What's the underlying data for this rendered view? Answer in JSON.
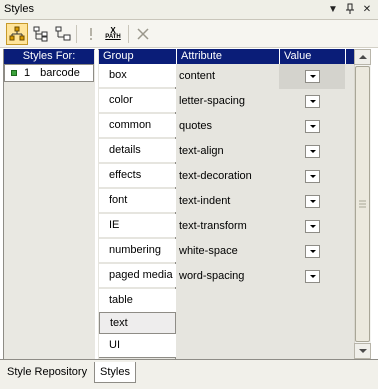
{
  "panel": {
    "title": "Styles",
    "controls": {
      "menu": "▼",
      "pin": "📌",
      "close": "✕"
    }
  },
  "toolbar": {
    "items": [
      {
        "name": "hierarchy-view-icon",
        "active": true
      },
      {
        "name": "tree-view-icon",
        "active": false
      },
      {
        "name": "tree-view-alt-icon",
        "active": false
      },
      {
        "name": "exclamation-icon",
        "active": false
      },
      {
        "name": "xpath-icon",
        "label_top": "X",
        "label_bottom": "PATH",
        "active": false
      },
      {
        "name": "cross-icon",
        "active": false
      }
    ]
  },
  "styles_for": {
    "header": "Styles For:",
    "items": [
      {
        "index": "1",
        "label": "barcode"
      }
    ]
  },
  "grid": {
    "columns": {
      "group": "Group",
      "attribute": "Attribute",
      "value": "Value"
    },
    "groups": [
      "box",
      "color",
      "common",
      "details",
      "effects",
      "font",
      "IE",
      "numbering",
      "paged media",
      "table",
      "text",
      "UI"
    ],
    "selected_group": "text",
    "attributes": [
      "content",
      "letter-spacing",
      "quotes",
      "text-align",
      "text-decoration",
      "text-indent",
      "text-transform",
      "white-space",
      "word-spacing"
    ]
  },
  "tabs": {
    "items": [
      "Style Repository",
      "Styles"
    ],
    "active": "Styles"
  },
  "colors": {
    "header_bg": "#0a1d78",
    "highlight_tool": "#ffe49a",
    "status_green": "#3ca23c"
  }
}
